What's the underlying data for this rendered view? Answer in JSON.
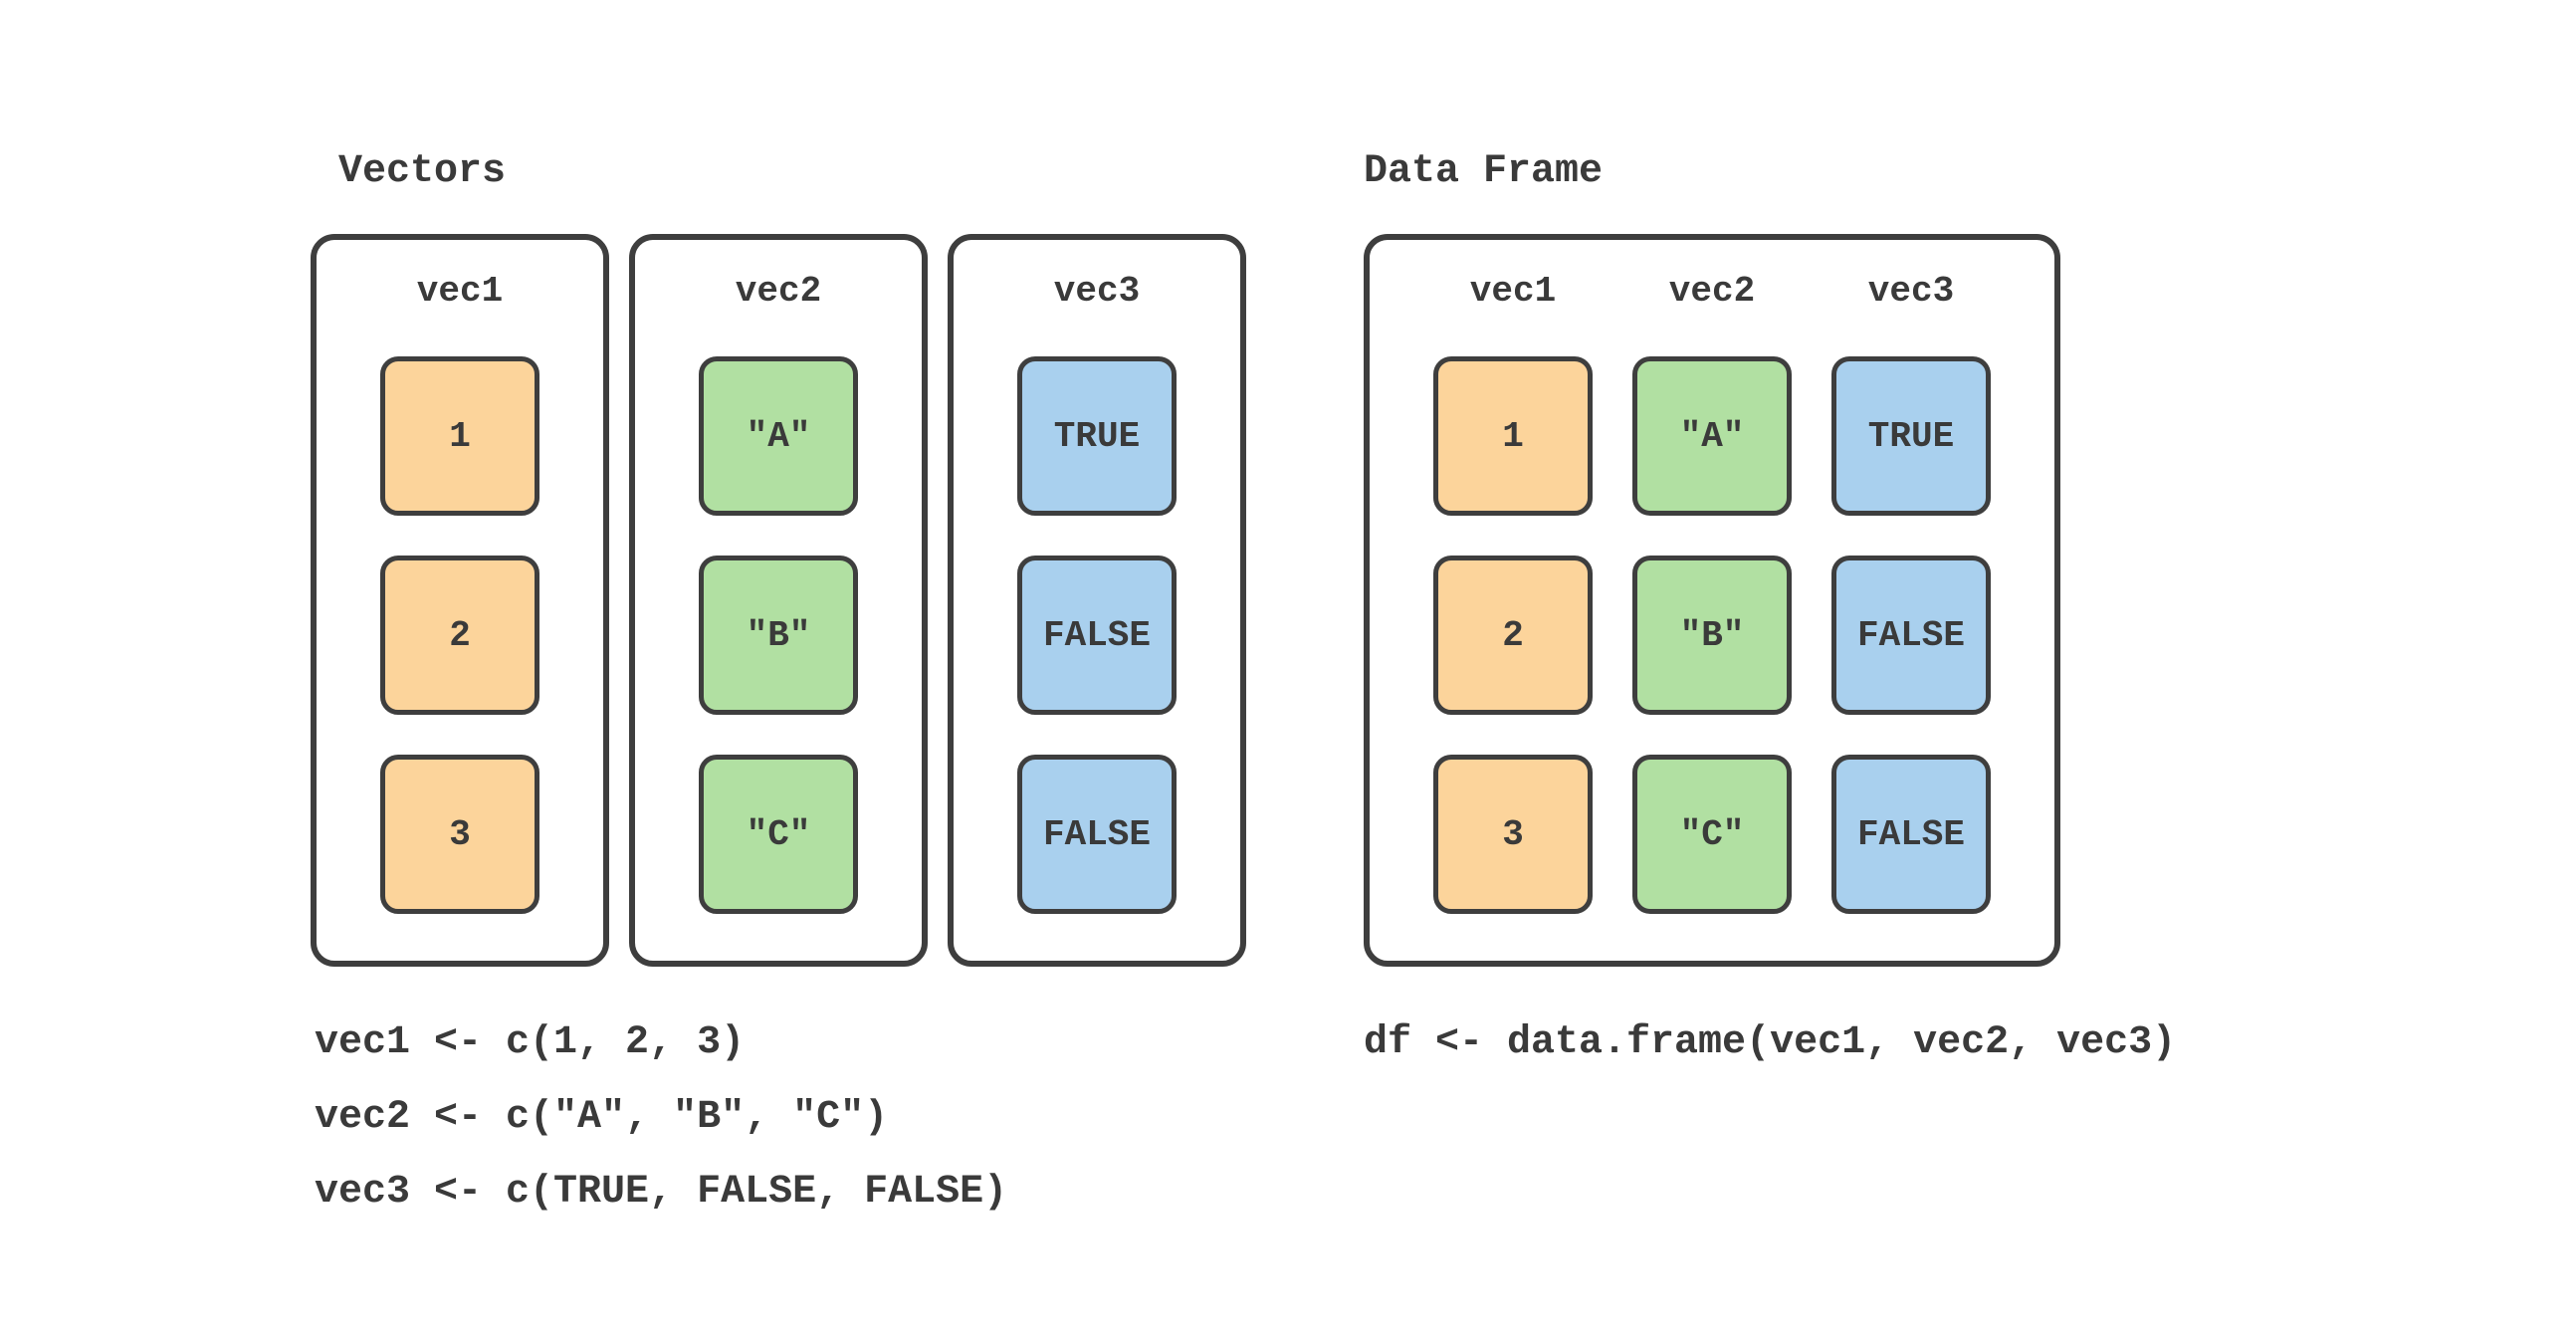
{
  "titles": {
    "vectors": "Vectors",
    "dataframe": "Data Frame"
  },
  "vectors": {
    "vec1": {
      "name": "vec1",
      "values": [
        "1",
        "2",
        "3"
      ]
    },
    "vec2": {
      "name": "vec2",
      "values": [
        "\"A\"",
        "\"B\"",
        "\"C\""
      ]
    },
    "vec3": {
      "name": "vec3",
      "values": [
        "TRUE",
        "FALSE",
        "FALSE"
      ]
    }
  },
  "dataframe": {
    "headers": [
      "vec1",
      "vec2",
      "vec3"
    ],
    "rows": [
      [
        "1",
        "\"A\"",
        "TRUE"
      ],
      [
        "2",
        "\"B\"",
        "FALSE"
      ],
      [
        "3",
        "\"C\"",
        "FALSE"
      ]
    ]
  },
  "code": {
    "vec1": "vec1 <- c(1, 2, 3)",
    "vec2": "vec2 <- c(\"A\", \"B\", \"C\")",
    "vec3": "vec3 <- c(TRUE, FALSE, FALSE)",
    "df": "df <- data.frame(vec1, vec2, vec3)"
  }
}
